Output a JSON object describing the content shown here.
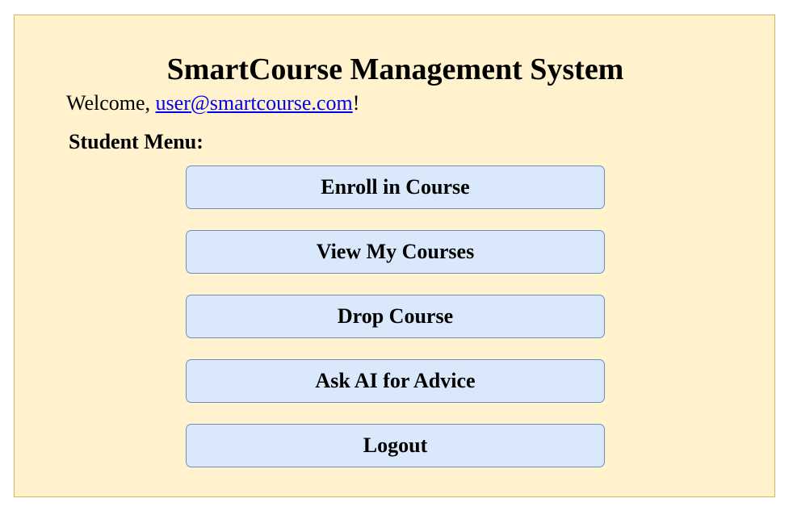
{
  "app": {
    "title": "SmartCourse Management System"
  },
  "welcome": {
    "prefix": "Welcome, ",
    "email": "user@smartcourse.com",
    "suffix": "!"
  },
  "menu": {
    "label": "Student Menu:",
    "items": [
      {
        "label": "Enroll in Course"
      },
      {
        "label": "View My Courses"
      },
      {
        "label": "Drop Course"
      },
      {
        "label": "Ask AI for Advice"
      },
      {
        "label": "Logout"
      }
    ]
  },
  "colors": {
    "panel_background": "#fff2cc",
    "panel_border": "#d6b656",
    "button_background": "#dae8fc",
    "button_border": "#6c8ebf",
    "link": "#0000ee"
  }
}
